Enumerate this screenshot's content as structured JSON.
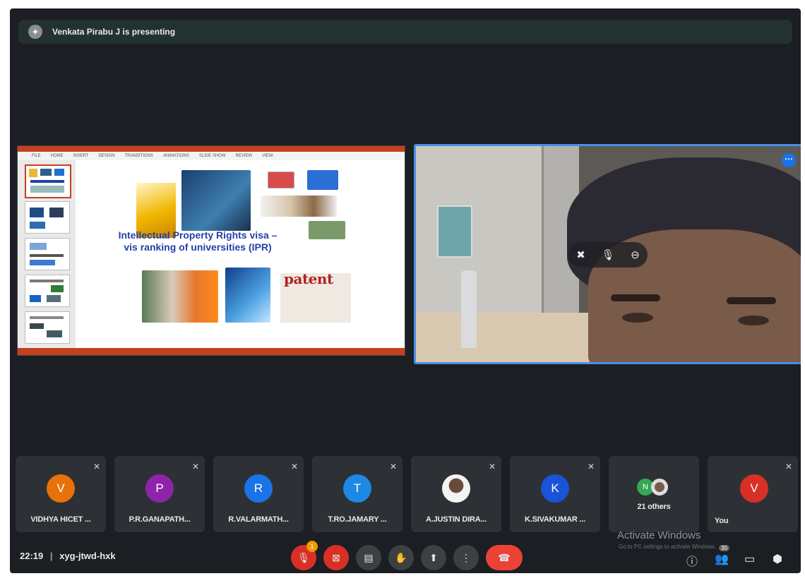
{
  "banner": {
    "avatar_initial": "✦",
    "text": "Venkata Pirabu J is presenting"
  },
  "slide": {
    "menu_items": [
      "FILE",
      "HOME",
      "INSERT",
      "DESIGN",
      "TRANSITIONS",
      "ANIMATIONS",
      "SLIDE SHOW",
      "REVIEW",
      "VIEW"
    ],
    "title_line1": "Intellectual Property Rights visa –",
    "title_line2": "vis ranking of universities  (IPR)",
    "patent_word": "patent",
    "colors": {
      "title": "#2340a8",
      "ribbon": "#c5401c"
    }
  },
  "camera": {
    "more_icon": "⋯",
    "pin_icon": "✖",
    "mic_icon": "🎙",
    "remove_icon": "⊖"
  },
  "participants": [
    {
      "name": "VIDHYA HICET ...",
      "initial": "V",
      "color": "#e8710a"
    },
    {
      "name": "P.R.GANAPATH...",
      "initial": "P",
      "color": "#8e24aa"
    },
    {
      "name": "R.VALARMATH...",
      "initial": "R",
      "color": "#1a73e8"
    },
    {
      "name": "T.RO.JAMARY ...",
      "initial": "T",
      "color": "#1e88e5"
    },
    {
      "name": "A.JUSTIN DIRA...",
      "initial": "",
      "color": "#cfd3d6"
    },
    {
      "name": "K.SIVAKUMAR ...",
      "initial": "K",
      "color": "#1a53d8"
    }
  ],
  "others": {
    "label": "21 others",
    "initial": "N",
    "color": "#34a853"
  },
  "you": {
    "label": "You",
    "initial": "V",
    "color": "#d93025"
  },
  "watermark": {
    "title": "Activate Windows",
    "sub": "Go to PC settings to activate Windows."
  },
  "footer": {
    "time": "22:19",
    "separator": "|",
    "meeting_code": "xyg-jtwd-hxk",
    "badge_count": "1",
    "people_count": "30"
  }
}
